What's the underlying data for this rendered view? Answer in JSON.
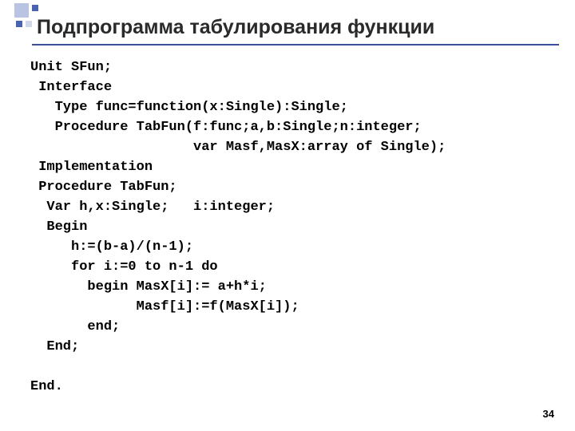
{
  "title": "Подпрограмма табулирования функции",
  "code": {
    "l1": "Unit SFun;",
    "l2": " Interface",
    "l3": "   Type func=function(x:Single):Single;",
    "l4": "   Procedure TabFun(f:func;a,b:Single;n:integer;",
    "l5": "                    var Masf,MasX:array of Single);",
    "l6": " Implementation",
    "l7": " Procedure TabFun;",
    "l8": "  Var h,x:Single;   i:integer;",
    "l9": "  Begin",
    "l10": "     h:=(b-a)/(n-1);",
    "l11": "     for i:=0 to n-1 do",
    "l12": "       begin MasX[i]:= a+h*i;",
    "l13": "             Masf[i]:=f(MasX[i]);",
    "l14": "       end;",
    "l15": "  End;",
    "l16": "",
    "l17": "End."
  },
  "page_number": "34"
}
